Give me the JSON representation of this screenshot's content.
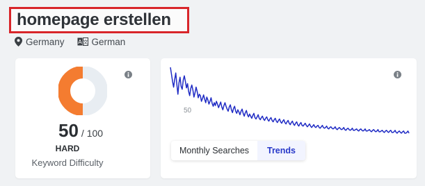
{
  "keyword": "homepage erstellen",
  "meta": {
    "country": "Germany",
    "language": "German",
    "location_icon": "location-pin-icon",
    "language_icon": "translate-icon"
  },
  "difficulty": {
    "score": "50",
    "max": "/ 100",
    "level": "HARD",
    "label": "Keyword Difficulty",
    "fraction": 0.5,
    "color": "#f47c30",
    "track_color": "#e8edf2",
    "info_icon": "info-icon"
  },
  "trend": {
    "y_tick": "50",
    "tabs": [
      {
        "label": "Monthly Searches",
        "active": false
      },
      {
        "label": "Trends",
        "active": true
      }
    ],
    "line_color": "#1f2bc4",
    "info_icon": "info-icon"
  },
  "chart_data": {
    "type": "line",
    "title": "",
    "xlabel": "",
    "ylabel": "",
    "y_ticks": [
      50
    ],
    "ylim": [
      0,
      100
    ],
    "series": [
      {
        "values": [
          100,
          90,
          80,
          72,
          83,
          92,
          76,
          62,
          78,
          86,
          73,
          69,
          82,
          88,
          80,
          71,
          77,
          66,
          60,
          70,
          75,
          68,
          58,
          64,
          72,
          66,
          57,
          62,
          60,
          52,
          56,
          61,
          55,
          50,
          58,
          54,
          48,
          52,
          57,
          49,
          45,
          50,
          46,
          52,
          48,
          43,
          47,
          51,
          44,
          40,
          46,
          50,
          45,
          41,
          38,
          44,
          47,
          40,
          36,
          42,
          45,
          38,
          35,
          40,
          37,
          33,
          38,
          41,
          35,
          31,
          36,
          39,
          33,
          30,
          34,
          31,
          28,
          32,
          35,
          29,
          27,
          30,
          33,
          28,
          26,
          29,
          31,
          27,
          25,
          28,
          30,
          26,
          24,
          27,
          29,
          25,
          23,
          26,
          28,
          24,
          22,
          25,
          27,
          23,
          21,
          24,
          26,
          22,
          20,
          23,
          25,
          21,
          19,
          22,
          24,
          20,
          18,
          21,
          23,
          19,
          17,
          20,
          22,
          18,
          17,
          19,
          21,
          18,
          16,
          18,
          20,
          17,
          15,
          17,
          19,
          16,
          15,
          17,
          18,
          15,
          14,
          16,
          18,
          15,
          14,
          15,
          17,
          14,
          13,
          15,
          16,
          14,
          13,
          14,
          16,
          13,
          12,
          14,
          15,
          13,
          12,
          13,
          15,
          12,
          11,
          13,
          14,
          12,
          11,
          12,
          14,
          11,
          11,
          12,
          13,
          11,
          10,
          12,
          13,
          11,
          10,
          11,
          13,
          10,
          10,
          11,
          12,
          10,
          9,
          11,
          12,
          10,
          9,
          10,
          12,
          9,
          9,
          10,
          11,
          9,
          8,
          10,
          11,
          9,
          8,
          10,
          11,
          8,
          8,
          9,
          11,
          8,
          7,
          9,
          10,
          8,
          7,
          9,
          10,
          7,
          7,
          8,
          10,
          7
        ]
      }
    ]
  }
}
